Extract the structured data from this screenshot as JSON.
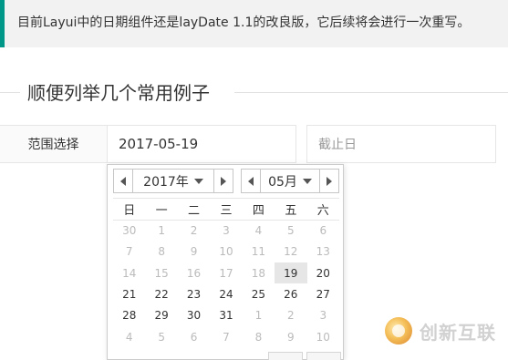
{
  "notice": {
    "text": "目前Layui中的日期组件还是layDate 1.1的改良版，它后续将会进行一次重写。",
    "accent_color": "#009688"
  },
  "section": {
    "title": "顺便列举几个常用例子"
  },
  "form": {
    "label": "范围选择",
    "start_value": "2017-05-19",
    "end_placeholder": "截止日"
  },
  "calendar": {
    "year_label": "2017年",
    "month_label": "05月",
    "weekdays": [
      "日",
      "一",
      "二",
      "三",
      "四",
      "五",
      "六"
    ],
    "weeks": [
      [
        {
          "d": "30",
          "m": true
        },
        {
          "d": "1",
          "m": true
        },
        {
          "d": "2",
          "m": true
        },
        {
          "d": "3",
          "m": true
        },
        {
          "d": "4",
          "m": true
        },
        {
          "d": "5",
          "m": true
        },
        {
          "d": "6",
          "m": true
        }
      ],
      [
        {
          "d": "7",
          "m": true
        },
        {
          "d": "8",
          "m": true
        },
        {
          "d": "9",
          "m": true
        },
        {
          "d": "10",
          "m": true
        },
        {
          "d": "11",
          "m": true
        },
        {
          "d": "12",
          "m": true
        },
        {
          "d": "13",
          "m": true
        }
      ],
      [
        {
          "d": "14",
          "m": true
        },
        {
          "d": "15",
          "m": true
        },
        {
          "d": "16",
          "m": true
        },
        {
          "d": "17",
          "m": true
        },
        {
          "d": "18",
          "m": true
        },
        {
          "d": "19",
          "m": false,
          "sel": true
        },
        {
          "d": "20",
          "m": false
        }
      ],
      [
        {
          "d": "21",
          "m": false
        },
        {
          "d": "22",
          "m": false
        },
        {
          "d": "23",
          "m": false
        },
        {
          "d": "24",
          "m": false
        },
        {
          "d": "25",
          "m": false
        },
        {
          "d": "26",
          "m": false
        },
        {
          "d": "27",
          "m": false
        }
      ],
      [
        {
          "d": "28",
          "m": false
        },
        {
          "d": "29",
          "m": false
        },
        {
          "d": "30",
          "m": false
        },
        {
          "d": "31",
          "m": false
        },
        {
          "d": "1",
          "m": true
        },
        {
          "d": "2",
          "m": true
        },
        {
          "d": "3",
          "m": true
        }
      ],
      [
        {
          "d": "4",
          "m": true
        },
        {
          "d": "5",
          "m": true
        },
        {
          "d": "6",
          "m": true
        },
        {
          "d": "7",
          "m": true
        },
        {
          "d": "8",
          "m": true
        },
        {
          "d": "9",
          "m": true
        },
        {
          "d": "10",
          "m": true
        }
      ]
    ]
  },
  "watermark": {
    "text": "创新互联"
  }
}
